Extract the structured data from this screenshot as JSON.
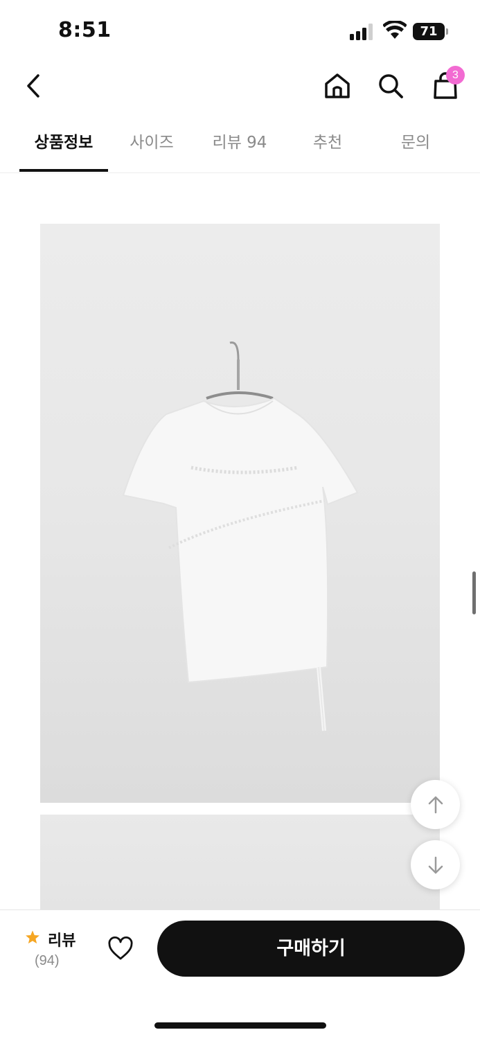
{
  "status_bar": {
    "time": "8:51",
    "battery": "71"
  },
  "header": {
    "cart_count": "3"
  },
  "tabs": [
    {
      "label": "상품정보",
      "active": true
    },
    {
      "label": "사이즈",
      "active": false
    },
    {
      "label": "리뷰 94",
      "active": false
    },
    {
      "label": "추천",
      "active": false
    },
    {
      "label": "문의",
      "active": false
    }
  ],
  "bottom_bar": {
    "review_label": "리뷰",
    "review_count": "(94)",
    "buy_label": "구매하기"
  },
  "colors": {
    "accent_badge": "#f26bd2",
    "star": "#f5a623",
    "primary_button": "#111111"
  },
  "icons": [
    "back-icon",
    "home-icon",
    "search-icon",
    "cart-icon",
    "arrow-up-icon",
    "arrow-down-icon",
    "star-icon",
    "heart-icon"
  ]
}
